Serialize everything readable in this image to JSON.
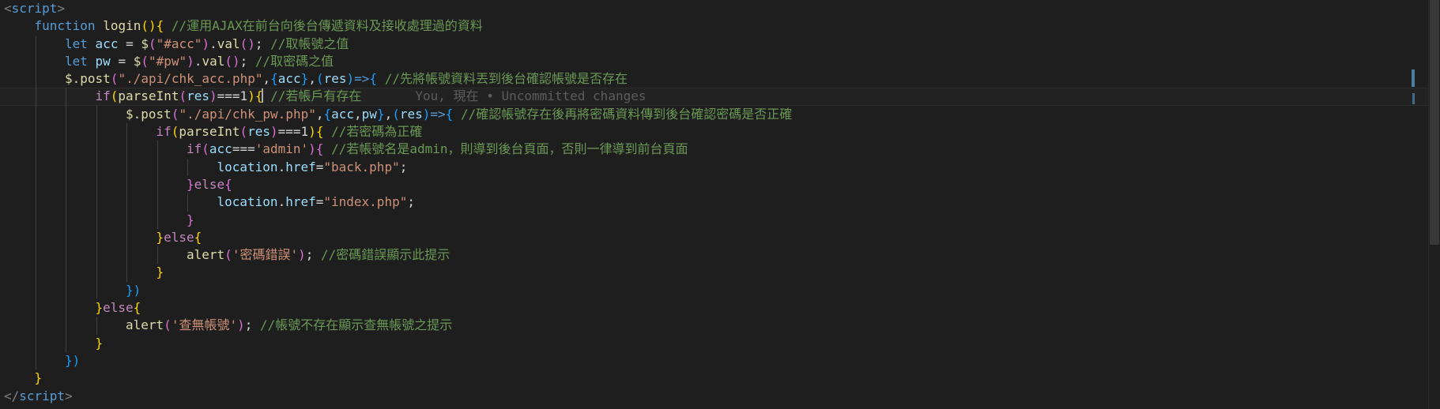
{
  "editor": {
    "lines": [
      {
        "indent": 0,
        "tokens": [
          {
            "c": "t-tag",
            "t": "<"
          },
          {
            "c": "t-tagname",
            "t": "script"
          },
          {
            "c": "t-tag",
            "t": ">"
          }
        ]
      },
      {
        "indent": 1,
        "tokens": [
          {
            "c": "t-kw",
            "t": "function"
          },
          {
            "c": "t-plain",
            "t": " "
          },
          {
            "c": "t-fn",
            "t": "login"
          },
          {
            "c": "t-b1",
            "t": "()"
          },
          {
            "c": "t-b1",
            "t": "{"
          },
          {
            "c": "t-plain",
            "t": " "
          },
          {
            "c": "t-cmt",
            "t": "//運用AJAX在前台向後台傳遞資料及接收處理過的資料"
          }
        ]
      },
      {
        "indent": 2,
        "tokens": [
          {
            "c": "t-kw",
            "t": "let"
          },
          {
            "c": "t-plain",
            "t": " "
          },
          {
            "c": "t-var",
            "t": "acc"
          },
          {
            "c": "t-plain",
            "t": " = "
          },
          {
            "c": "t-fn",
            "t": "$"
          },
          {
            "c": "t-b2",
            "t": "("
          },
          {
            "c": "t-str",
            "t": "\"#acc\""
          },
          {
            "c": "t-b2",
            "t": ")"
          },
          {
            "c": "t-plain",
            "t": "."
          },
          {
            "c": "t-fn",
            "t": "val"
          },
          {
            "c": "t-b2",
            "t": "()"
          },
          {
            "c": "t-plain",
            "t": "; "
          },
          {
            "c": "t-cmt",
            "t": "//取帳號之值"
          }
        ]
      },
      {
        "indent": 2,
        "tokens": [
          {
            "c": "t-kw",
            "t": "let"
          },
          {
            "c": "t-plain",
            "t": " "
          },
          {
            "c": "t-var",
            "t": "pw"
          },
          {
            "c": "t-plain",
            "t": " = "
          },
          {
            "c": "t-fn",
            "t": "$"
          },
          {
            "c": "t-b2",
            "t": "("
          },
          {
            "c": "t-str",
            "t": "\"#pw\""
          },
          {
            "c": "t-b2",
            "t": ")"
          },
          {
            "c": "t-plain",
            "t": "."
          },
          {
            "c": "t-fn",
            "t": "val"
          },
          {
            "c": "t-b2",
            "t": "()"
          },
          {
            "c": "t-plain",
            "t": "; "
          },
          {
            "c": "t-cmt",
            "t": "//取密碼之值"
          }
        ]
      },
      {
        "indent": 2,
        "tokens": [
          {
            "c": "t-fn",
            "t": "$"
          },
          {
            "c": "t-plain",
            "t": "."
          },
          {
            "c": "t-fn",
            "t": "post"
          },
          {
            "c": "t-b2",
            "t": "("
          },
          {
            "c": "t-str",
            "t": "\"./api/chk_acc.php\""
          },
          {
            "c": "t-plain",
            "t": ","
          },
          {
            "c": "t-b3",
            "t": "{"
          },
          {
            "c": "t-var",
            "t": "acc"
          },
          {
            "c": "t-b3",
            "t": "}"
          },
          {
            "c": "t-plain",
            "t": ","
          },
          {
            "c": "t-b3",
            "t": "("
          },
          {
            "c": "t-var",
            "t": "res"
          },
          {
            "c": "t-b3",
            "t": ")"
          },
          {
            "c": "t-kw",
            "t": "=>"
          },
          {
            "c": "t-b3",
            "t": "{"
          },
          {
            "c": "t-plain",
            "t": " "
          },
          {
            "c": "t-cmt",
            "t": "//先將帳號資料丟到後台確認帳號是否存在"
          }
        ]
      },
      {
        "indent": 3,
        "current": true,
        "cursor_after_token": 8,
        "blame": "You, 現在 • Uncommitted changes",
        "tokens": [
          {
            "c": "t-ctrl",
            "t": "if"
          },
          {
            "c": "t-b1",
            "t": "("
          },
          {
            "c": "t-fn",
            "t": "parseInt"
          },
          {
            "c": "t-b2",
            "t": "("
          },
          {
            "c": "t-var",
            "t": "res"
          },
          {
            "c": "t-b2",
            "t": ")"
          },
          {
            "c": "t-plain",
            "t": "===1"
          },
          {
            "c": "t-b1",
            "t": ")"
          },
          {
            "c": "t-b1",
            "t": "{"
          },
          {
            "c": "t-plain",
            "t": " "
          },
          {
            "c": "t-cmt",
            "t": "//若帳戶有存在"
          }
        ]
      },
      {
        "indent": 4,
        "tokens": [
          {
            "c": "t-fn",
            "t": "$"
          },
          {
            "c": "t-plain",
            "t": "."
          },
          {
            "c": "t-fn",
            "t": "post"
          },
          {
            "c": "t-b2",
            "t": "("
          },
          {
            "c": "t-str",
            "t": "\"./api/chk_pw.php\""
          },
          {
            "c": "t-plain",
            "t": ","
          },
          {
            "c": "t-b3",
            "t": "{"
          },
          {
            "c": "t-var",
            "t": "acc"
          },
          {
            "c": "t-plain",
            "t": ","
          },
          {
            "c": "t-var",
            "t": "pw"
          },
          {
            "c": "t-b3",
            "t": "}"
          },
          {
            "c": "t-plain",
            "t": ","
          },
          {
            "c": "t-b3",
            "t": "("
          },
          {
            "c": "t-var",
            "t": "res"
          },
          {
            "c": "t-b3",
            "t": ")"
          },
          {
            "c": "t-kw",
            "t": "=>"
          },
          {
            "c": "t-b3",
            "t": "{"
          },
          {
            "c": "t-plain",
            "t": " "
          },
          {
            "c": "t-cmt",
            "t": "//確認帳號存在後再將密碼資料傳到後台確認密碼是否正確"
          }
        ]
      },
      {
        "indent": 5,
        "tokens": [
          {
            "c": "t-ctrl",
            "t": "if"
          },
          {
            "c": "t-b1",
            "t": "("
          },
          {
            "c": "t-fn",
            "t": "parseInt"
          },
          {
            "c": "t-b2",
            "t": "("
          },
          {
            "c": "t-var",
            "t": "res"
          },
          {
            "c": "t-b2",
            "t": ")"
          },
          {
            "c": "t-plain",
            "t": "===1"
          },
          {
            "c": "t-b1",
            "t": ")"
          },
          {
            "c": "t-b1",
            "t": "{"
          },
          {
            "c": "t-plain",
            "t": " "
          },
          {
            "c": "t-cmt",
            "t": "//若密碼為正確"
          }
        ]
      },
      {
        "indent": 6,
        "tokens": [
          {
            "c": "t-ctrl",
            "t": "if"
          },
          {
            "c": "t-b2",
            "t": "("
          },
          {
            "c": "t-var",
            "t": "acc"
          },
          {
            "c": "t-plain",
            "t": "==="
          },
          {
            "c": "t-str",
            "t": "'admin'"
          },
          {
            "c": "t-b2",
            "t": ")"
          },
          {
            "c": "t-b2",
            "t": "{"
          },
          {
            "c": "t-plain",
            "t": " "
          },
          {
            "c": "t-cmt",
            "t": "//若帳號名是admin，則導到後台頁面，否則一律導到前台頁面"
          }
        ]
      },
      {
        "indent": 7,
        "tokens": [
          {
            "c": "t-var",
            "t": "location"
          },
          {
            "c": "t-plain",
            "t": "."
          },
          {
            "c": "t-var",
            "t": "href"
          },
          {
            "c": "t-plain",
            "t": "="
          },
          {
            "c": "t-str",
            "t": "\"back.php\""
          },
          {
            "c": "t-plain",
            "t": ";"
          }
        ]
      },
      {
        "indent": 6,
        "tokens": [
          {
            "c": "t-b2",
            "t": "}"
          },
          {
            "c": "t-ctrl",
            "t": "else"
          },
          {
            "c": "t-b2",
            "t": "{"
          }
        ]
      },
      {
        "indent": 7,
        "tokens": [
          {
            "c": "t-var",
            "t": "location"
          },
          {
            "c": "t-plain",
            "t": "."
          },
          {
            "c": "t-var",
            "t": "href"
          },
          {
            "c": "t-plain",
            "t": "="
          },
          {
            "c": "t-str",
            "t": "\"index.php\""
          },
          {
            "c": "t-plain",
            "t": ";"
          }
        ]
      },
      {
        "indent": 6,
        "tokens": [
          {
            "c": "t-b2",
            "t": "}"
          }
        ]
      },
      {
        "indent": 5,
        "tokens": [
          {
            "c": "t-b1",
            "t": "}"
          },
          {
            "c": "t-ctrl",
            "t": "else"
          },
          {
            "c": "t-b1",
            "t": "{"
          }
        ]
      },
      {
        "indent": 6,
        "tokens": [
          {
            "c": "t-fn",
            "t": "alert"
          },
          {
            "c": "t-b2",
            "t": "("
          },
          {
            "c": "t-str",
            "t": "'密碼錯誤'"
          },
          {
            "c": "t-b2",
            "t": ")"
          },
          {
            "c": "t-plain",
            "t": "; "
          },
          {
            "c": "t-cmt",
            "t": "//密碼錯誤顯示此提示"
          }
        ]
      },
      {
        "indent": 5,
        "tokens": [
          {
            "c": "t-b1",
            "t": "}"
          }
        ]
      },
      {
        "indent": 4,
        "tokens": [
          {
            "c": "t-b3",
            "t": "})"
          }
        ]
      },
      {
        "indent": 3,
        "tokens": [
          {
            "c": "t-b1",
            "t": "}"
          },
          {
            "c": "t-ctrl",
            "t": "else"
          },
          {
            "c": "t-b1",
            "t": "{"
          }
        ]
      },
      {
        "indent": 4,
        "tokens": [
          {
            "c": "t-fn",
            "t": "alert"
          },
          {
            "c": "t-b2",
            "t": "("
          },
          {
            "c": "t-str",
            "t": "'查無帳號'"
          },
          {
            "c": "t-b2",
            "t": ")"
          },
          {
            "c": "t-plain",
            "t": "; "
          },
          {
            "c": "t-cmt",
            "t": "//帳號不存在顯示查無帳號之提示"
          }
        ]
      },
      {
        "indent": 3,
        "tokens": [
          {
            "c": "t-b1",
            "t": "}"
          }
        ]
      },
      {
        "indent": 2,
        "tokens": [
          {
            "c": "t-b3",
            "t": "})"
          }
        ]
      },
      {
        "indent": 1,
        "tokens": [
          {
            "c": "t-b1",
            "t": "}"
          }
        ]
      },
      {
        "indent": 0,
        "tokens": [
          {
            "c": "t-tag",
            "t": "</"
          },
          {
            "c": "t-tagname",
            "t": "script"
          },
          {
            "c": "t-tag",
            "t": ">"
          }
        ]
      }
    ]
  }
}
